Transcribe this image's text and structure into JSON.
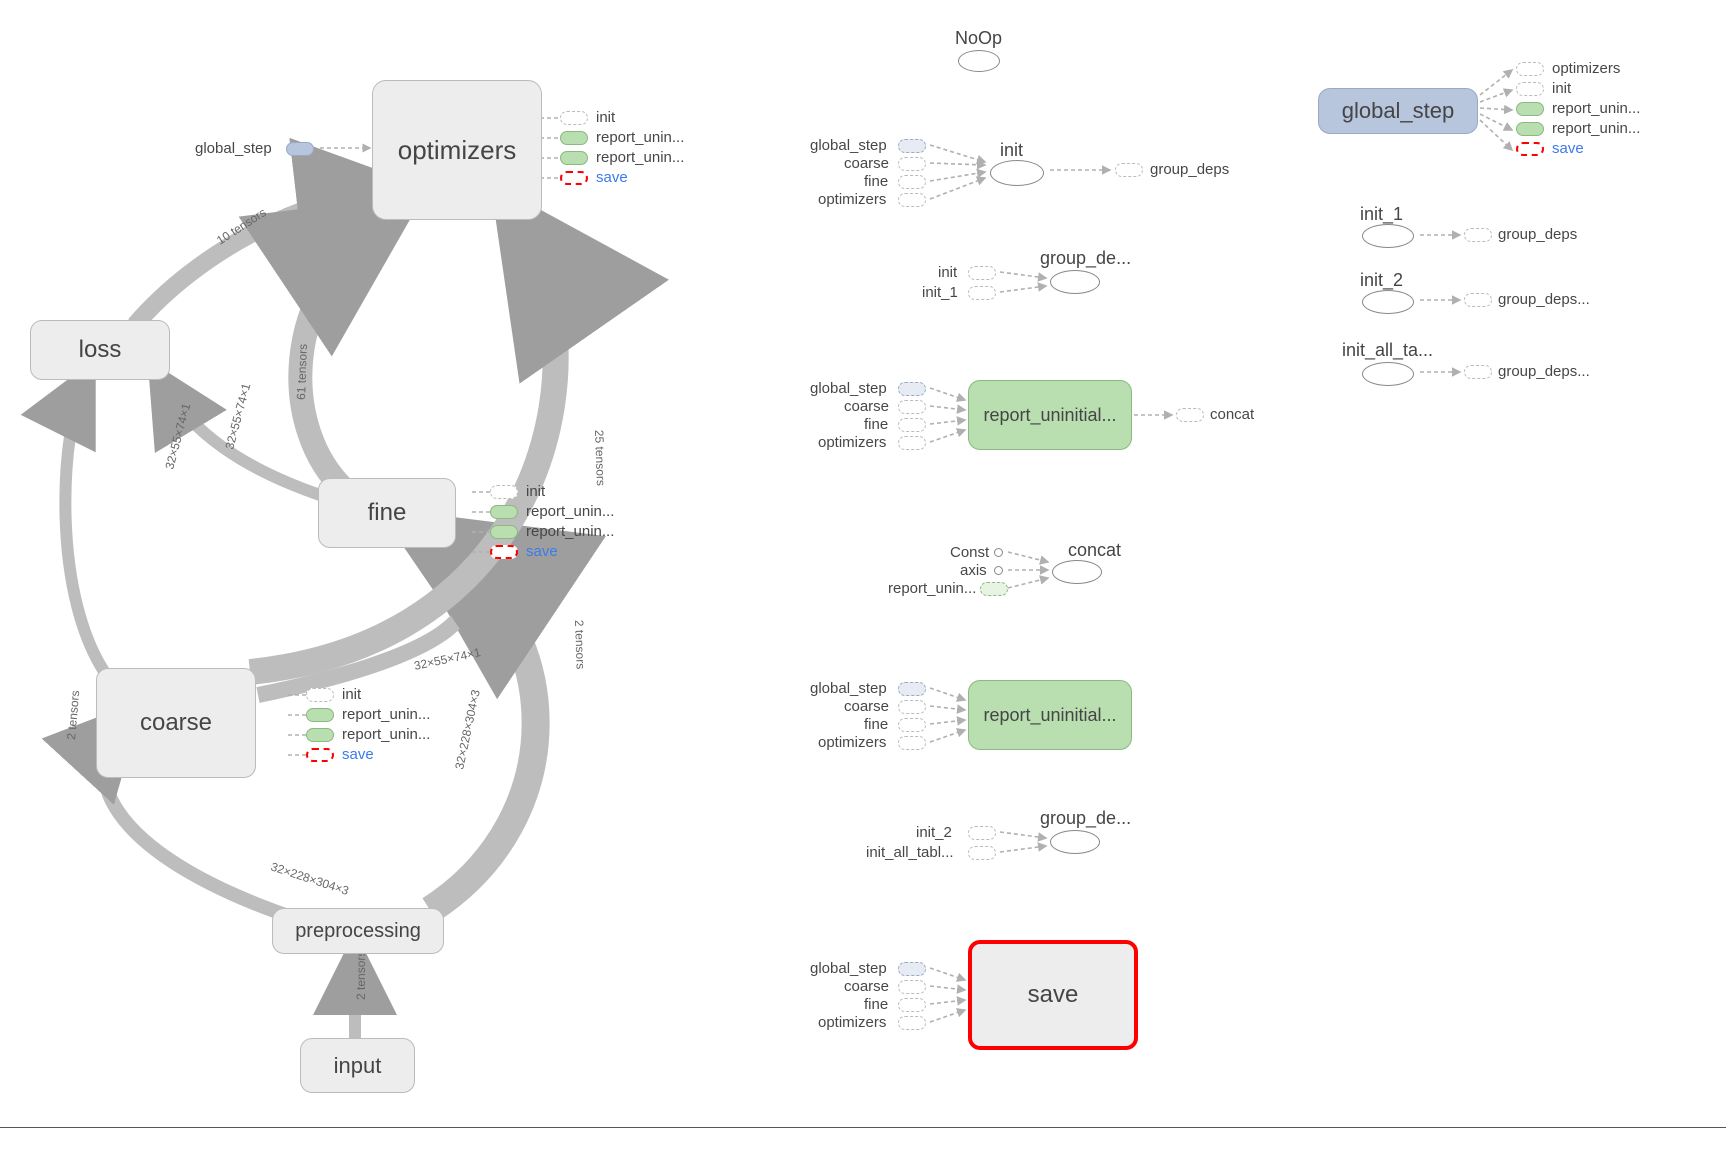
{
  "left": {
    "nodes": {
      "optimizers": "optimizers",
      "loss": "loss",
      "fine": "fine",
      "coarse": "coarse",
      "preprocessing": "preprocessing",
      "input": "input"
    },
    "global_step_label": "global_step",
    "port_group": {
      "init": "init",
      "ru1": "report_unin...",
      "ru2": "report_unin...",
      "save": "save"
    },
    "edge_labels": {
      "ten10": "10 tensors",
      "ten61": "61 tensors",
      "ten25": "25 tensors",
      "ten2a": "2 tensors",
      "ten2b": "2 tensors",
      "ten2c": "2 tensors",
      "shape_a": "32×55×74×1",
      "shape_b": "32×55×74×1",
      "shape_c": "32×228×304×3",
      "shape_d": "32×228×304×3"
    }
  },
  "mid": {
    "noop": "NoOp",
    "init_block": {
      "global_step": "global_step",
      "coarse": "coarse",
      "fine": "fine",
      "optimizers": "optimizers",
      "init": "init",
      "group_deps": "group_deps"
    },
    "group_de_block": {
      "init": "init",
      "init1": "init_1",
      "title": "group_de..."
    },
    "report1": {
      "title": "report_uninitial...",
      "global_step": "global_step",
      "coarse": "coarse",
      "fine": "fine",
      "optimizers": "optimizers",
      "out": "concat"
    },
    "concat_block": {
      "const": "Const",
      "axis": "axis",
      "report": "report_unin...",
      "title": "concat"
    },
    "report2": {
      "title": "report_uninitial...",
      "global_step": "global_step",
      "coarse": "coarse",
      "fine": "fine",
      "optimizers": "optimizers"
    },
    "group_de_block2": {
      "init2": "init_2",
      "init_all": "init_all_tabl...",
      "title": "group_de..."
    },
    "save": {
      "title": "save",
      "global_step": "global_step",
      "coarse": "coarse",
      "fine": "fine",
      "optimizers": "optimizers"
    }
  },
  "right": {
    "global_step": "global_step",
    "outputs": {
      "optimizers": "optimizers",
      "init": "init",
      "ru1": "report_unin...",
      "ru2": "report_unin...",
      "save": "save"
    },
    "init1_block": {
      "title": "init_1",
      "out": "group_deps"
    },
    "init2_block": {
      "title": "init_2",
      "out": "group_deps..."
    },
    "init_all_block": {
      "title": "init_all_ta...",
      "out": "group_deps..."
    }
  }
}
